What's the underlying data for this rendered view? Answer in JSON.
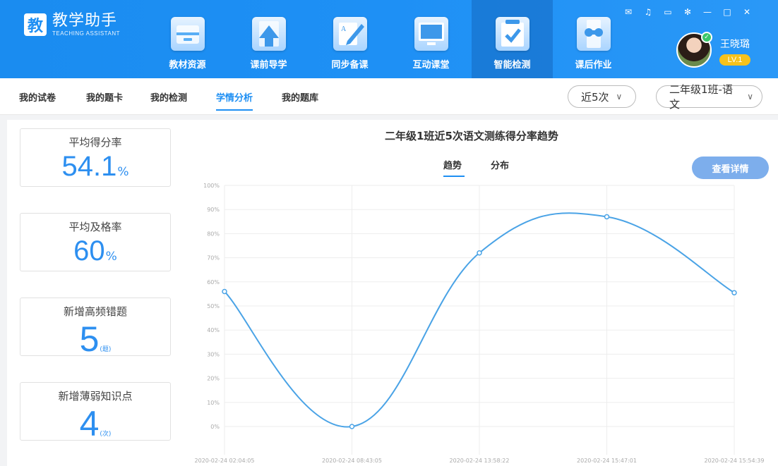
{
  "header": {
    "logo_glyph": "教",
    "app_name": "教学助手",
    "app_name_en": "TEACHING ASSISTANT",
    "nav": [
      {
        "label": "教材资源",
        "icon": "textbook-resources-icon"
      },
      {
        "label": "课前导学",
        "icon": "pre-class-guide-icon"
      },
      {
        "label": "同步备课",
        "icon": "lesson-prep-icon"
      },
      {
        "label": "互动课堂",
        "icon": "interactive-classroom-icon"
      },
      {
        "label": "智能检测",
        "icon": "smart-test-icon",
        "active": true
      },
      {
        "label": "课后作业",
        "icon": "homework-icon"
      }
    ],
    "window_controls": [
      "mail-icon",
      "bell-icon",
      "chat-icon",
      "settings-icon",
      "minimize-icon",
      "maximize-icon",
      "close-icon"
    ],
    "user": {
      "name": "王晓璐",
      "level": "LV.1"
    }
  },
  "subtabs": [
    {
      "label": "我的试卷"
    },
    {
      "label": "我的题卡"
    },
    {
      "label": "我的检测"
    },
    {
      "label": "学情分析",
      "active": true
    },
    {
      "label": "我的题库"
    }
  ],
  "filters": {
    "range": "近5次",
    "class_subject": "二年级1班-语文"
  },
  "stats": [
    {
      "title": "平均得分率",
      "value": "54.1",
      "unit": "%"
    },
    {
      "title": "平均及格率",
      "value": "60",
      "unit": "%"
    },
    {
      "title": "新增高频错题",
      "value": "5",
      "unit": "(题)"
    },
    {
      "title": "新增薄弱知识点",
      "value": "4",
      "unit": "(次)"
    }
  ],
  "chart_tabs": {
    "trend": "趋势",
    "distribution": "分布"
  },
  "detail_button": "查看详情",
  "colors": {
    "accent": "#1e8ff3",
    "line": "#4aa3e6"
  },
  "chart_data": {
    "type": "line",
    "title": "二年级1班近5次语文测练得分率趋势",
    "x": [
      "2020-02-24 02:04:05",
      "2020-02-24 08:43:05",
      "2020-02-24 13:58:22",
      "2020-02-24 15:47:01",
      "2020-02-24 15:54:39"
    ],
    "series": [
      {
        "values": [
          56,
          0,
          72,
          87,
          55.5
        ]
      }
    ],
    "y_ticks": [
      "0%",
      "10%",
      "20%",
      "30%",
      "40%",
      "50%",
      "60%",
      "70%",
      "80%",
      "90%",
      "100%"
    ],
    "ylim": [
      0,
      100
    ],
    "grid": true,
    "smooth": true
  }
}
